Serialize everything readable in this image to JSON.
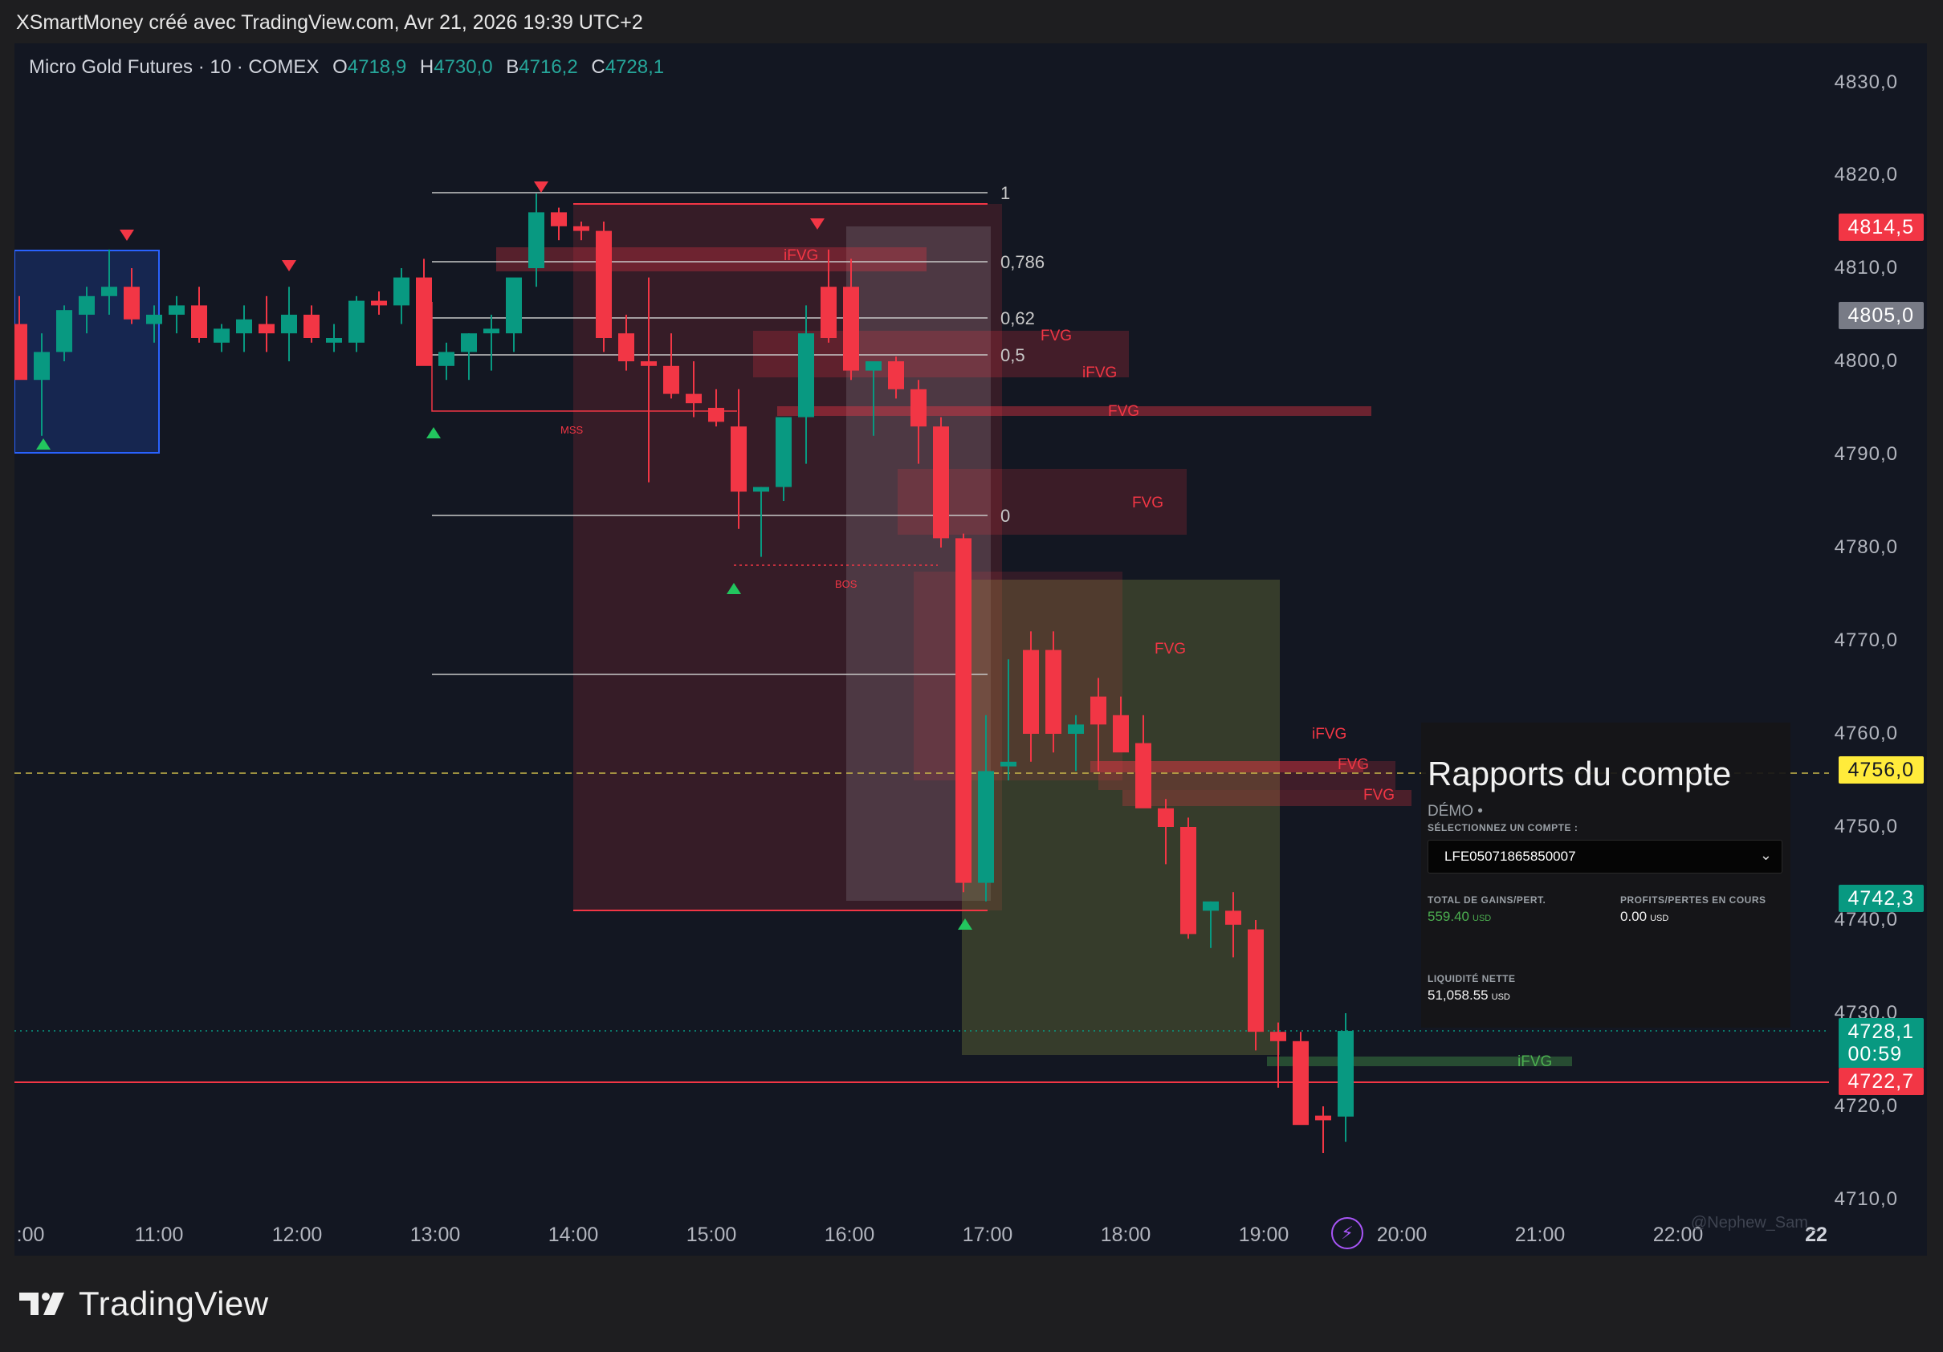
{
  "header": {
    "text": "XSmartMoney créé avec TradingView.com, Avr 21, 2026 19:39 UTC+2"
  },
  "legend": {
    "symbol": "Micro Gold Futures · 10 · COMEX",
    "o_label": "O",
    "o": "4718,9",
    "h_label": "H",
    "h": "4730,0",
    "l_label": "B",
    "l": "4716,2",
    "c_label": "C",
    "c": "4728,1"
  },
  "yaxis": {
    "ticks": [
      "4830,0",
      "4820,0",
      "4810,0",
      "4800,0",
      "4790,0",
      "4780,0",
      "4770,0",
      "4760,0",
      "4750,0",
      "4740,0",
      "4730,0",
      "4720,0",
      "4710,0"
    ]
  },
  "xaxis": {
    "ticks": [
      ":00",
      "11:00",
      "12:00",
      "13:00",
      "14:00",
      "15:00",
      "16:00",
      "17:00",
      "18:00",
      "19:00",
      "20:00",
      "21:00",
      "22:00",
      "22"
    ]
  },
  "price_labels": [
    {
      "text": "4814,5",
      "color": "#f23645"
    },
    {
      "text": "4805,0",
      "color": "#787b86"
    },
    {
      "text": "4756,0",
      "color": "#ffeb3b"
    },
    {
      "text": "4742,3",
      "color": "#089981"
    },
    {
      "text": "4728,1",
      "color": "#089981",
      "countdown": "00:59"
    },
    {
      "text": "4722,7",
      "color": "#f23645"
    }
  ],
  "fib_levels": [
    "1",
    "0,786",
    "0,62",
    "0,5",
    "0"
  ],
  "annotations": {
    "ifvg": "iFVG",
    "fvg": "FVG",
    "mss": "MSS",
    "bos": "BOS"
  },
  "account_panel": {
    "title": "Rapports du compte",
    "mode": "DÉMO •",
    "select_hint": "SÉLECTIONNEZ UN COMPTE :",
    "account_id": "LFE05071865850007",
    "total_pl_label": "TOTAL DE GAINS/PERT.",
    "total_pl": "559.40",
    "open_pl_label": "PROFITS/PERTES EN COURS",
    "open_pl": "0.00",
    "net_liq_label": "LIQUIDITÉ NETTE",
    "net_liq": "51,058.55",
    "currency": "USD"
  },
  "watermark": "@Nephew_Sam_",
  "footer": {
    "brand": "TradingView"
  },
  "colors": {
    "up": "#089981",
    "down": "#f23645",
    "background": "#131722"
  }
}
